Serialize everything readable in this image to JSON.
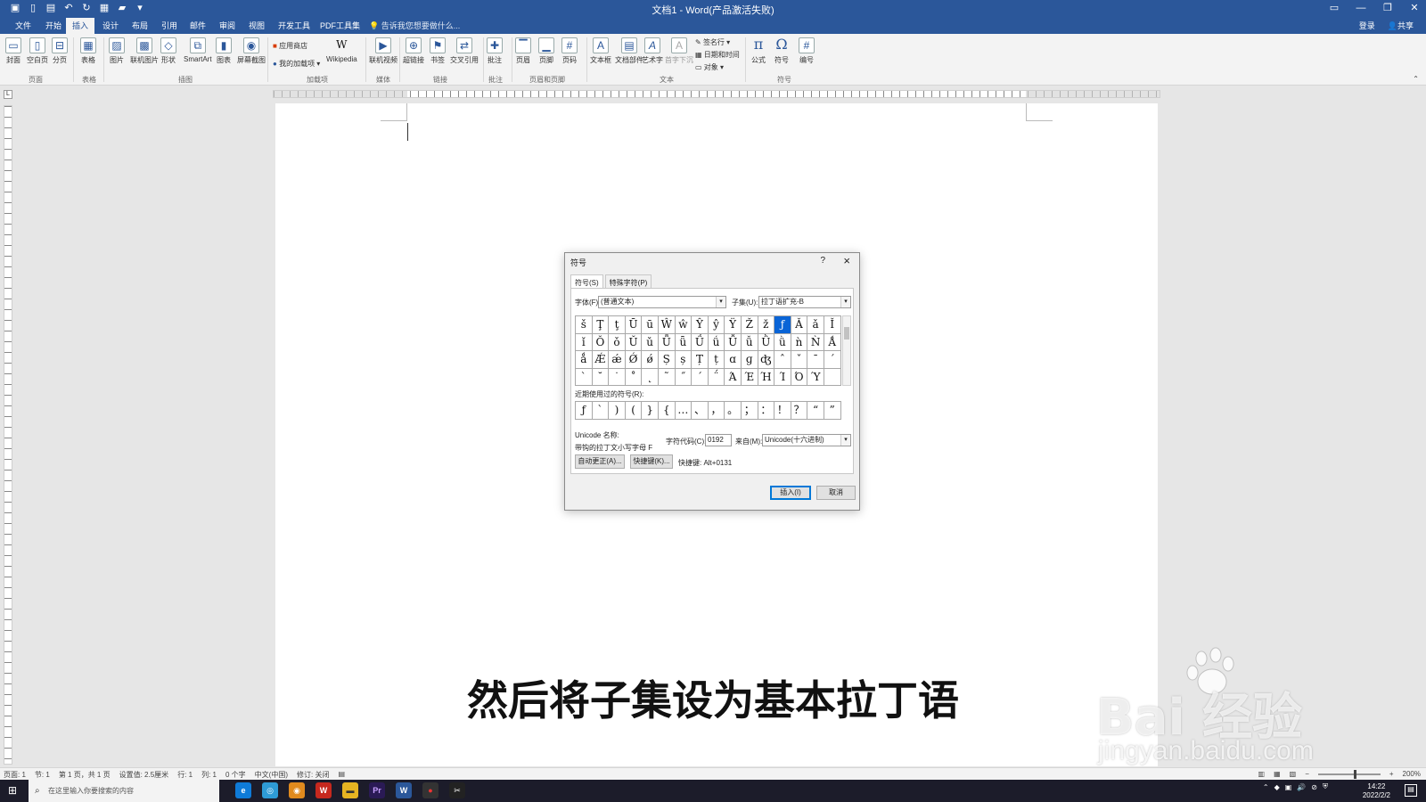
{
  "window": {
    "title": "文档1 - Word(产品激活失败)"
  },
  "ribbon_tabs": [
    "文件",
    "开始",
    "插入",
    "设计",
    "布局",
    "引用",
    "邮件",
    "审阅",
    "视图",
    "开发工具",
    "PDF工具集"
  ],
  "tell_me": "告诉我您想要做什么...",
  "account": {
    "signin": "登录",
    "share": "共享"
  },
  "ribbon": {
    "pages": {
      "cover": "封面",
      "blank": "空白页",
      "break": "分页",
      "group": "页面"
    },
    "tables": {
      "table": "表格",
      "group": "表格"
    },
    "illustrations": {
      "picture": "图片",
      "online_picture": "联机图片",
      "shapes": "形状",
      "smartart": "SmartArt",
      "chart": "图表",
      "screenshot": "屏幕截图",
      "group": "插图"
    },
    "addins": {
      "store": "应用商店",
      "my_addins": "我的加载项",
      "wikipedia": "Wikipedia",
      "group": "加载项"
    },
    "media": {
      "online_video": "联机视频",
      "group": "媒体"
    },
    "links": {
      "hyperlink": "超链接",
      "bookmark": "书签",
      "cross_ref": "交叉引用",
      "group": "链接"
    },
    "comments": {
      "comment": "批注",
      "group": "批注"
    },
    "header_footer": {
      "header": "页眉",
      "footer": "页脚",
      "page_number": "页码",
      "group": "页眉和页脚"
    },
    "text": {
      "textbox": "文本框",
      "quick_parts": "文档部件",
      "wordart": "艺术字",
      "dropcap": "首字下沉",
      "signature": "签名行",
      "datetime": "日期和时间",
      "object": "对象",
      "group": "文本"
    },
    "symbols": {
      "equation": "公式",
      "symbol": "符号",
      "number": "编号",
      "group": "符号"
    }
  },
  "dialog": {
    "title": "符号",
    "help": "?",
    "close": "×",
    "tabs": [
      "符号(S)",
      "特殊字符(P)"
    ],
    "font_label": "字体(F):",
    "font_value": "(普通文本)",
    "subset_label": "子集(U):",
    "subset_value": "拉丁语扩充-B",
    "grid": [
      [
        "š",
        "Ţ",
        "ţ",
        "Ū",
        "ū",
        "Ŵ",
        "ŵ",
        "Ŷ",
        "ŷ",
        "Ÿ",
        "Ž",
        "ž",
        "ƒ",
        "Ǎ",
        "ǎ",
        "Ǐ"
      ],
      [
        "ǐ",
        "Ǒ",
        "ǒ",
        "Ǔ",
        "ǔ",
        "Ǖ",
        "ǖ",
        "Ǘ",
        "ǘ",
        "Ǚ",
        "ǚ",
        "Ǜ",
        "ǜ",
        "ǹ",
        "Ǹ",
        "Ǻ"
      ],
      [
        "ǻ",
        "Ǽ",
        "ǽ",
        "Ǿ",
        "ǿ",
        "Ș",
        "ș",
        "Ț",
        "ț",
        "ɑ",
        "ɡ",
        "ʤ",
        "ˆ",
        "ˇ",
        "ˉ",
        "ˊ"
      ],
      [
        "ˋ",
        "˘",
        "˙",
        "˚",
        "˛",
        "˜",
        "˝",
        "΄",
        "΅",
        "Ά",
        "Έ",
        "Ή",
        "Ί",
        "Ό",
        "Ύ",
        ""
      ]
    ],
    "selected_index": 12,
    "recent_label": "近期使用过的符号(R):",
    "recent": [
      "ƒ",
      "`",
      ")",
      "(",
      "}",
      "{",
      "…",
      "、",
      "，",
      "。",
      "；",
      "：",
      "！",
      "？",
      "“",
      "”"
    ],
    "unicode_name_label": "Unicode 名称:",
    "unicode_name": "带钩的拉丁文小写字母 F",
    "char_code_label": "字符代码(C):",
    "char_code": "0192",
    "from_label": "来自(M):",
    "from_value": "Unicode(十六进制)",
    "autocorrect_btn": "自动更正(A)...",
    "shortcut_btn": "快捷键(K)...",
    "shortcut_text": "快捷键: Alt+0131",
    "insert_btn": "插入(I)",
    "cancel_btn": "取消"
  },
  "statusbar": {
    "left": [
      "页面: 1",
      "节: 1",
      "第 1 页，共 1 页",
      "设置值: 2.5厘米",
      "行: 1",
      "列: 1",
      "0 个字",
      "中文(中国)",
      "修订: 关闭"
    ],
    "zoom": "200%"
  },
  "taskbar": {
    "search_placeholder": "在这里输入你要搜索的内容",
    "time": "14:22",
    "date": "2022/2/2"
  },
  "subtitle": "然后将子集设为基本拉丁语",
  "watermark": {
    "logo": "Bai  经验",
    "url": "jingyan.baidu.com"
  },
  "colors": {
    "word_blue": "#2b579a",
    "selected_cell": "#0a64d6"
  }
}
